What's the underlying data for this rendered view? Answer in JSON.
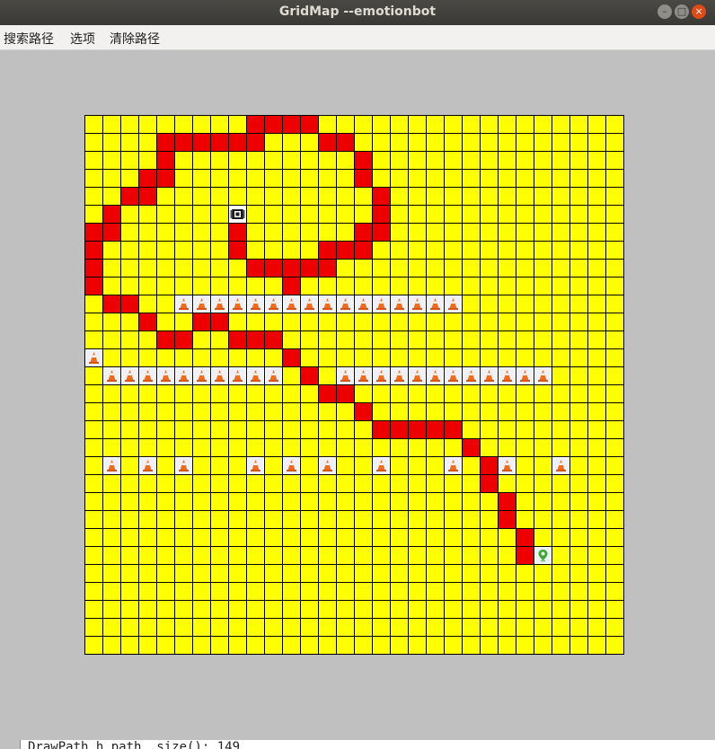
{
  "window": {
    "title": "GridMap --emotionbot"
  },
  "menu": {
    "items": [
      "搜索路径",
      "选项",
      "清除路径"
    ]
  },
  "grid": {
    "rows": 30,
    "cols": 30,
    "colors": {
      "free": "#ffff00",
      "path": "#ee0000",
      "line": "#000000"
    },
    "robot": [
      8,
      5
    ],
    "goal": [
      25,
      24
    ],
    "obstacles": [
      [
        0,
        13
      ],
      [
        1,
        14
      ],
      [
        1,
        19
      ],
      [
        2,
        14
      ],
      [
        3,
        14
      ],
      [
        3,
        19
      ],
      [
        4,
        14
      ],
      [
        5,
        10
      ],
      [
        5,
        14
      ],
      [
        5,
        19
      ],
      [
        6,
        10
      ],
      [
        6,
        14
      ],
      [
        7,
        10
      ],
      [
        7,
        14
      ],
      [
        8,
        10
      ],
      [
        8,
        14
      ],
      [
        9,
        10
      ],
      [
        9,
        14
      ],
      [
        9,
        19
      ],
      [
        10,
        10
      ],
      [
        10,
        14
      ],
      [
        11,
        10
      ],
      [
        11,
        19
      ],
      [
        12,
        10
      ],
      [
        13,
        10
      ],
      [
        13,
        19
      ],
      [
        14,
        10
      ],
      [
        14,
        14
      ],
      [
        15,
        10
      ],
      [
        15,
        14
      ],
      [
        16,
        10
      ],
      [
        16,
        14
      ],
      [
        16,
        19
      ],
      [
        17,
        10
      ],
      [
        17,
        14
      ],
      [
        18,
        10
      ],
      [
        18,
        14
      ],
      [
        19,
        10
      ],
      [
        19,
        14
      ],
      [
        20,
        10
      ],
      [
        20,
        14
      ],
      [
        20,
        19
      ],
      [
        21,
        14
      ],
      [
        22,
        14
      ],
      [
        23,
        14
      ],
      [
        23,
        19
      ],
      [
        24,
        14
      ],
      [
        25,
        14
      ],
      [
        26,
        19
      ]
    ],
    "path": [
      [
        8,
        6
      ],
      [
        8,
        7
      ],
      [
        9,
        8
      ],
      [
        10,
        8
      ],
      [
        11,
        8
      ],
      [
        11,
        9
      ],
      [
        12,
        8
      ],
      [
        13,
        8
      ],
      [
        13,
        7
      ],
      [
        14,
        7
      ],
      [
        15,
        7
      ],
      [
        15,
        6
      ],
      [
        16,
        6
      ],
      [
        16,
        5
      ],
      [
        16,
        4
      ],
      [
        15,
        3
      ],
      [
        15,
        2
      ],
      [
        14,
        1
      ],
      [
        13,
        1
      ],
      [
        12,
        0
      ],
      [
        11,
        0
      ],
      [
        10,
        0
      ],
      [
        9,
        0
      ],
      [
        9,
        1
      ],
      [
        8,
        1
      ],
      [
        7,
        1
      ],
      [
        6,
        1
      ],
      [
        5,
        1
      ],
      [
        4,
        1
      ],
      [
        4,
        2
      ],
      [
        4,
        3
      ],
      [
        3,
        3
      ],
      [
        3,
        4
      ],
      [
        2,
        4
      ],
      [
        1,
        5
      ],
      [
        1,
        6
      ],
      [
        0,
        6
      ],
      [
        0,
        7
      ],
      [
        0,
        8
      ],
      [
        0,
        9
      ],
      [
        1,
        10
      ],
      [
        2,
        10
      ],
      [
        3,
        11
      ],
      [
        4,
        12
      ],
      [
        5,
        12
      ],
      [
        6,
        11
      ],
      [
        7,
        11
      ],
      [
        8,
        12
      ],
      [
        9,
        12
      ],
      [
        10,
        12
      ],
      [
        11,
        13
      ],
      [
        12,
        14
      ],
      [
        13,
        15
      ],
      [
        14,
        15
      ],
      [
        15,
        16
      ],
      [
        16,
        17
      ],
      [
        17,
        17
      ],
      [
        18,
        17
      ],
      [
        19,
        17
      ],
      [
        20,
        17
      ],
      [
        21,
        18
      ],
      [
        22,
        19
      ],
      [
        22,
        20
      ],
      [
        23,
        21
      ],
      [
        23,
        22
      ],
      [
        24,
        23
      ],
      [
        24,
        24
      ]
    ]
  },
  "console": {
    "text": "DrawPath h_path .size(): 149"
  }
}
